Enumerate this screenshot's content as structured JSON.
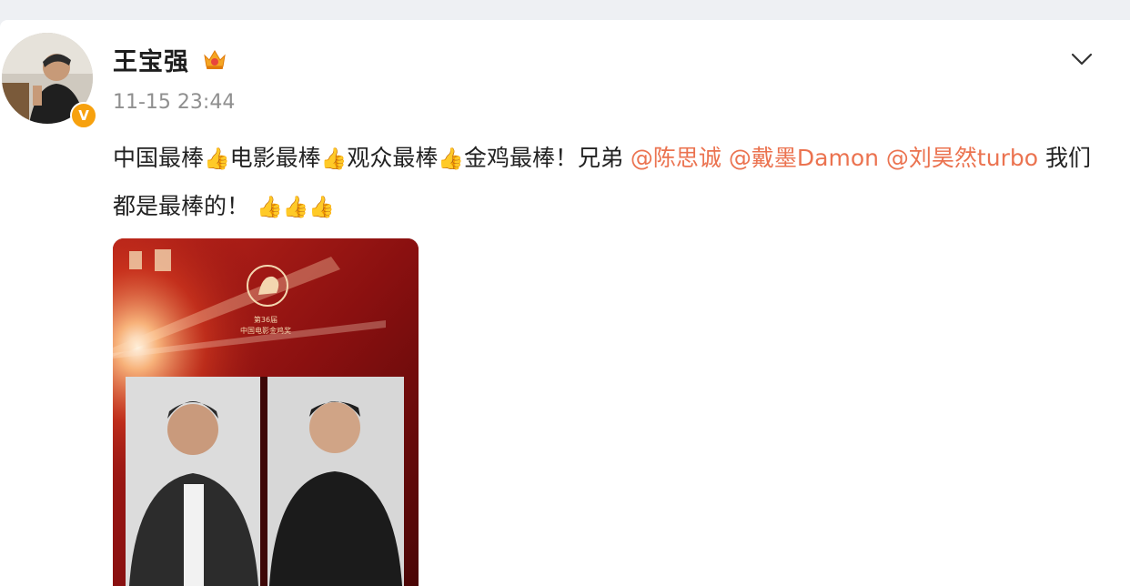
{
  "user": {
    "name": "王宝强",
    "verified_badge": "V",
    "timestamp": "11-15 23:44"
  },
  "post": {
    "segments": [
      {
        "text": "中国最棒",
        "type": "text"
      },
      {
        "text": "👍",
        "type": "emoji"
      },
      {
        "text": "电影最棒",
        "type": "text"
      },
      {
        "text": "👍",
        "type": "emoji"
      },
      {
        "text": "观众最棒",
        "type": "text"
      },
      {
        "text": "👍",
        "type": "emoji"
      },
      {
        "text": "金鸡最棒！兄弟 ",
        "type": "text"
      },
      {
        "text": "@陈思诚",
        "type": "mention"
      },
      {
        "text": " ",
        "type": "text"
      },
      {
        "text": "@戴墨Damon",
        "type": "mention"
      },
      {
        "text": " ",
        "type": "text"
      },
      {
        "text": "@刘昊然turbo",
        "type": "mention"
      },
      {
        "text": " 我们都是最棒的！ ",
        "type": "text"
      },
      {
        "text": "👍👍👍",
        "type": "emoji"
      }
    ]
  },
  "poster": {
    "line1": "第36届",
    "line2": "中国电影金鸡奖"
  },
  "icons": {
    "chevron": "chevron-down-icon",
    "crown": "crown-icon",
    "thumbs": "thumbs-up-icon"
  },
  "colors": {
    "mention": "#eb7350",
    "badge": "#f7a10e",
    "poster_red": "#a3160f"
  }
}
